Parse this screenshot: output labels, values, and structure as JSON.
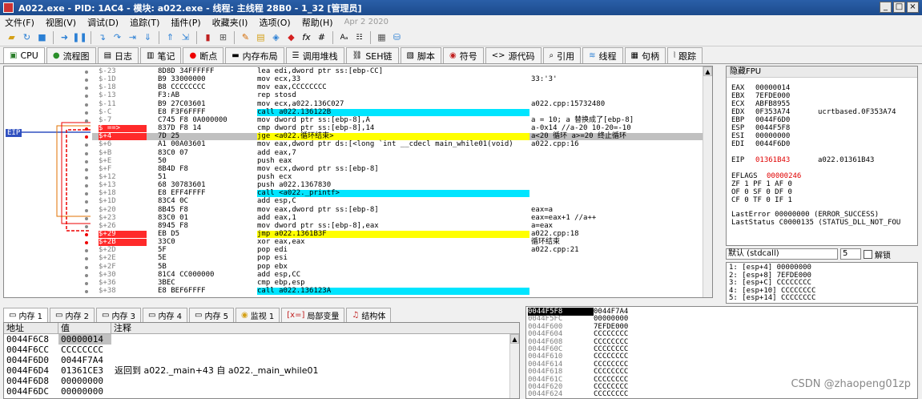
{
  "window": {
    "title": "A022.exe - PID: 1AC4 - 模块: a022.exe - 线程: 主线程 28B0 - 1_32 [管理员]",
    "buttons": [
      "_",
      "□",
      "×"
    ]
  },
  "menu": {
    "items": [
      "文件(F)",
      "视图(V)",
      "调试(D)",
      "追踪(T)",
      "插件(P)",
      "收藏夹(I)",
      "选项(O)",
      "帮助(H)"
    ],
    "date": "Apr 2 2020"
  },
  "tabs": [
    {
      "label": "CPU",
      "icon": "cpu-icon"
    },
    {
      "label": "流程图",
      "icon": "graph-icon"
    },
    {
      "label": "日志",
      "icon": "log-icon"
    },
    {
      "label": "笔记",
      "icon": "notes-icon"
    },
    {
      "label": "断点",
      "icon": "breakpoint-icon"
    },
    {
      "label": "内存布局",
      "icon": "memory-map-icon"
    },
    {
      "label": "调用堆栈",
      "icon": "callstack-icon"
    },
    {
      "label": "SEH链",
      "icon": "seh-icon"
    },
    {
      "label": "脚本",
      "icon": "script-icon"
    },
    {
      "label": "符号",
      "icon": "symbol-icon"
    },
    {
      "label": "源代码",
      "icon": "source-icon"
    },
    {
      "label": "引用",
      "icon": "references-icon"
    },
    {
      "label": "线程",
      "icon": "threads-icon"
    },
    {
      "label": "句柄",
      "icon": "handles-icon"
    },
    {
      "label": "跟踪",
      "icon": "trace-icon"
    }
  ],
  "disasm": {
    "eip_label": "EIP",
    "rows": [
      {
        "off": "$-23",
        "bytes": "8D8D 34FFFFFF",
        "ins": "lea edi,dword ptr ss:[ebp-CC]",
        "cmt": ""
      },
      {
        "off": "$-1D",
        "bytes": "B9 33000000",
        "ins": "mov ecx,33",
        "cmt": "33:'3'"
      },
      {
        "off": "$-18",
        "bytes": "B8 CCCCCCCC",
        "ins": "mov eax,CCCCCCCC",
        "cmt": ""
      },
      {
        "off": "$-13",
        "bytes": "F3:AB",
        "ins": "rep stosd",
        "cmt": ""
      },
      {
        "off": "$-11",
        "bytes": "B9 27C03601",
        "ins": "mov ecx,a022.136C027",
        "cmt": "a022.cpp:15732480"
      },
      {
        "off": "$-C",
        "bytes": "E8 F3F6FFFF",
        "ins": "call a022.136122B",
        "cmt": ""
      },
      {
        "off": "$-7",
        "bytes": "C745 F8 0A000000",
        "ins": "mov dword ptr ss:[ebp-8],A",
        "cmt": "a = 10; a 替换成了[ebp-8]"
      },
      {
        "off": "$ ==>",
        "bytes": "837D F8 14",
        "ins": "cmp dword ptr ss:[ebp-8],14",
        "cmt": "a-0x14 //a-20  10-20=-10"
      },
      {
        "off": "$+4",
        "bytes": "7D 25",
        "ins": "jge <a022.循环结束>",
        "cmt": "a<20 循环  a>=20 终止循环"
      },
      {
        "off": "$+6",
        "bytes": "A1 00A03601",
        "ins": "mov eax,dword ptr ds:[<long `int __cdecl main_while01(void)",
        "cmt": "a022.cpp:16"
      },
      {
        "off": "$+B",
        "bytes": "83C0 07",
        "ins": "add eax,7",
        "cmt": ""
      },
      {
        "off": "$+E",
        "bytes": "50",
        "ins": "push eax",
        "cmt": ""
      },
      {
        "off": "$+F",
        "bytes": "8B4D F8",
        "ins": "mov ecx,dword ptr ss:[ebp-8]",
        "cmt": ""
      },
      {
        "off": "$+12",
        "bytes": "51",
        "ins": "push ecx",
        "cmt": ""
      },
      {
        "off": "$+13",
        "bytes": "68 30783601",
        "ins": "push a022.1367830",
        "cmt": ""
      },
      {
        "off": "$+18",
        "bytes": "E8 EFF4FFFF",
        "ins": "call <a022._printf>",
        "cmt": ""
      },
      {
        "off": "$+1D",
        "bytes": "83C4 0C",
        "ins": "add esp,C",
        "cmt": ""
      },
      {
        "off": "$+20",
        "bytes": "8B45 F8",
        "ins": "mov eax,dword ptr ss:[ebp-8]",
        "cmt": "eax=a"
      },
      {
        "off": "$+23",
        "bytes": "83C0 01",
        "ins": "add eax,1",
        "cmt": "eax=eax+1 //a++"
      },
      {
        "off": "$+26",
        "bytes": "8945 F8",
        "ins": "mov dword ptr ss:[ebp-8],eax",
        "cmt": "a=eax"
      },
      {
        "off": "$+29",
        "bytes": "EB D5",
        "ins": "jmp a022.1361B3F",
        "cmt": "a022.cpp:18"
      },
      {
        "off": "$+2B",
        "bytes": "33C0",
        "ins": "xor eax,eax",
        "cmt": "循环结束"
      },
      {
        "off": "$+2D",
        "bytes": "5F",
        "ins": "pop edi",
        "cmt": "a022.cpp:21"
      },
      {
        "off": "$+2E",
        "bytes": "5E",
        "ins": "pop esi",
        "cmt": ""
      },
      {
        "off": "$+2F",
        "bytes": "5B",
        "ins": "pop ebx",
        "cmt": ""
      },
      {
        "off": "$+30",
        "bytes": "81C4 CC000000",
        "ins": "add esp,CC",
        "cmt": ""
      },
      {
        "off": "$+36",
        "bytes": "3BEC",
        "ins": "cmp ebp,esp",
        "cmt": ""
      },
      {
        "off": "$+38",
        "bytes": "E8 BEF6FFFF",
        "ins": "call a022.136123A",
        "cmt": ""
      }
    ]
  },
  "registers": {
    "header": "隐藏FPU",
    "rows": [
      {
        "name": "EAX",
        "val": "00000014",
        "extra": ""
      },
      {
        "name": "EBX",
        "val": "7EFDE000",
        "extra": ""
      },
      {
        "name": "ECX",
        "val": "ABFB8955",
        "extra": ""
      },
      {
        "name": "EDX",
        "val": "0F353A74",
        "extra": "ucrtbased.0F353A74"
      },
      {
        "name": "EBP",
        "val": "0044F6D0",
        "extra": ""
      },
      {
        "name": "ESP",
        "val": "0044F5F8",
        "extra": ""
      },
      {
        "name": "ESI",
        "val": "00000000",
        "extra": ""
      },
      {
        "name": "EDI",
        "val": "0044F6D0",
        "extra": ""
      }
    ],
    "eip": {
      "name": "EIP",
      "val": "01361B43",
      "extra": "a022.01361B43"
    },
    "eflags": {
      "name": "EFLAGS",
      "val": "00000246"
    },
    "flags_lines": [
      "ZF 1  PF 1  AF 0",
      "OF 0  SF 0  DF 0",
      "CF 0  TF 0  IF 1"
    ],
    "last_error": "LastError  00000000 (ERROR_SUCCESS)",
    "last_status": "LastStatus C0000135 (STATUS_DLL_NOT_FOU"
  },
  "callconv": {
    "selected": "默认 (stdcall)",
    "count": "5",
    "unlock_label": "解锁"
  },
  "args": [
    "1: [esp+4] 00000000",
    "2: [esp+8] 7EFDE000",
    "3: [esp+C] CCCCCCCC",
    "4: [esp+10] CCCCCCCC",
    "5: [esp+14] CCCCCCCC"
  ],
  "bottom_tabs": [
    "内存 1",
    "内存 2",
    "内存 3",
    "内存 4",
    "内存 5",
    "监视 1",
    "局部变量",
    "结构体"
  ],
  "dump": {
    "headers": [
      "地址",
      "值",
      "注释"
    ],
    "rows": [
      {
        "a": "0044F6C8",
        "v": "00000014",
        "c": ""
      },
      {
        "a": "0044F6CC",
        "v": "CCCCCCCC",
        "c": ""
      },
      {
        "a": "0044F6D0",
        "v": "0044F7A4",
        "c": ""
      },
      {
        "a": "0044F6D4",
        "v": "01361CE3",
        "c": "返回到 a022._main+43 自 a022._main_while01"
      },
      {
        "a": "0044F6D8",
        "v": "00000000",
        "c": ""
      },
      {
        "a": "0044F6DC",
        "v": "00000000",
        "c": ""
      }
    ]
  },
  "stack": {
    "rows": [
      {
        "a": "0044F5F8",
        "v": "0044F7A4"
      },
      {
        "a": "0044F5FC",
        "v": "00000000"
      },
      {
        "a": "0044F600",
        "v": "7EFDE000"
      },
      {
        "a": "0044F604",
        "v": "CCCCCCCC"
      },
      {
        "a": "0044F608",
        "v": "CCCCCCCC"
      },
      {
        "a": "0044F60C",
        "v": "CCCCCCCC"
      },
      {
        "a": "0044F610",
        "v": "CCCCCCCC"
      },
      {
        "a": "0044F614",
        "v": "CCCCCCCC"
      },
      {
        "a": "0044F618",
        "v": "CCCCCCCC"
      },
      {
        "a": "0044F61C",
        "v": "CCCCCCCC"
      },
      {
        "a": "0044F620",
        "v": "CCCCCCCC"
      },
      {
        "a": "0044F624",
        "v": "CCCCCCCC"
      }
    ]
  },
  "watermark": "CSDN @zhaopeng01zp"
}
